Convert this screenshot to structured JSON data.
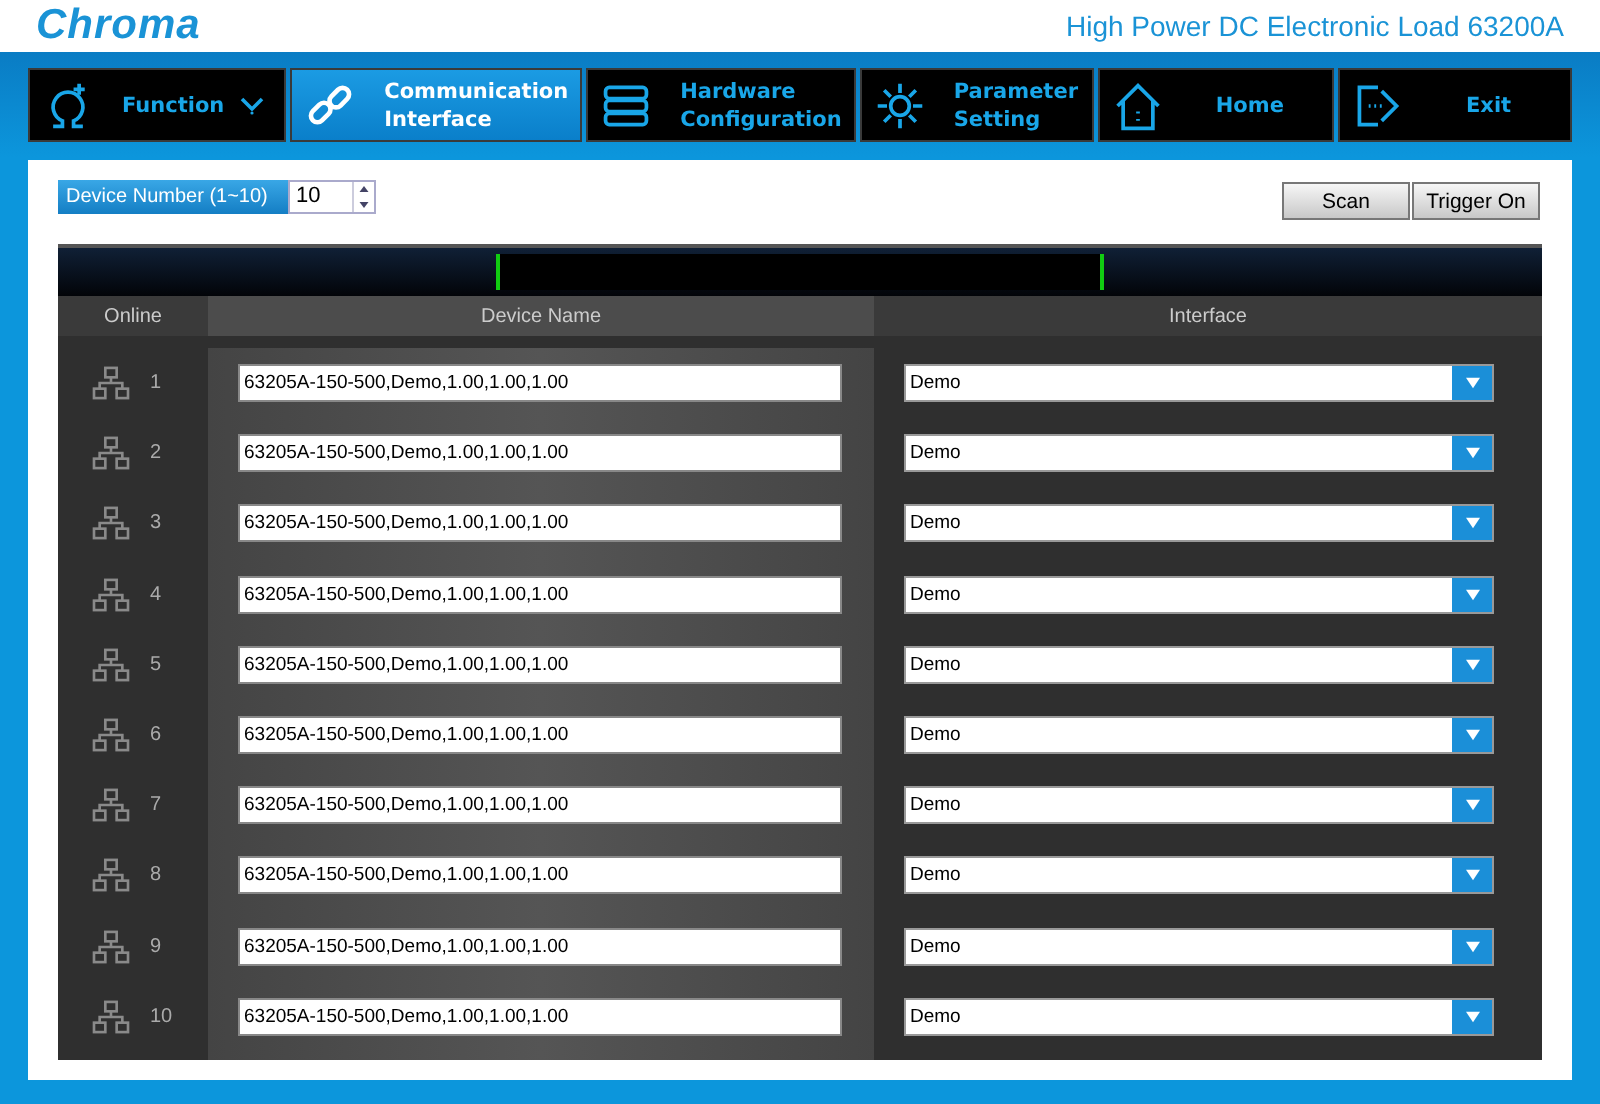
{
  "header": {
    "logo": "Chroma",
    "title": "High Power DC Electronic Load 63200A"
  },
  "nav": [
    {
      "label": "Function",
      "selected": false,
      "has_menu": true
    },
    {
      "label": "Communication\nInterface",
      "selected": true,
      "has_menu": false
    },
    {
      "label": "Hardware\nConfiguration",
      "selected": false,
      "has_menu": false
    },
    {
      "label": "Parameter\nSetting",
      "selected": false,
      "has_menu": false
    },
    {
      "label": "Home",
      "selected": false,
      "has_menu": false
    },
    {
      "label": "Exit",
      "selected": false,
      "has_menu": false
    }
  ],
  "device_number": {
    "label": "Device Number (1~10)",
    "value": "10"
  },
  "buttons": [
    "Scan",
    "Trigger On"
  ],
  "table": {
    "columns": [
      "Online",
      "Device Name",
      "Interface"
    ],
    "rows": [
      {
        "number": "1",
        "device_name": "63205A-150-500,Demo,1.00,1.00,1.00",
        "interface": "Demo"
      },
      {
        "number": "2",
        "device_name": "63205A-150-500,Demo,1.00,1.00,1.00",
        "interface": "Demo"
      },
      {
        "number": "3",
        "device_name": "63205A-150-500,Demo,1.00,1.00,1.00",
        "interface": "Demo"
      },
      {
        "number": "4",
        "device_name": "63205A-150-500,Demo,1.00,1.00,1.00",
        "interface": "Demo"
      },
      {
        "number": "5",
        "device_name": "63205A-150-500,Demo,1.00,1.00,1.00",
        "interface": "Demo"
      },
      {
        "number": "6",
        "device_name": "63205A-150-500,Demo,1.00,1.00,1.00",
        "interface": "Demo"
      },
      {
        "number": "7",
        "device_name": "63205A-150-500,Demo,1.00,1.00,1.00",
        "interface": "Demo"
      },
      {
        "number": "8",
        "device_name": "63205A-150-500,Demo,1.00,1.00,1.00",
        "interface": "Demo"
      },
      {
        "number": "9",
        "device_name": "63205A-150-500,Demo,1.00,1.00,1.00",
        "interface": "Demo"
      },
      {
        "number": "10",
        "device_name": "63205A-150-500,Demo,1.00,1.00,1.00",
        "interface": "Demo"
      }
    ]
  }
}
